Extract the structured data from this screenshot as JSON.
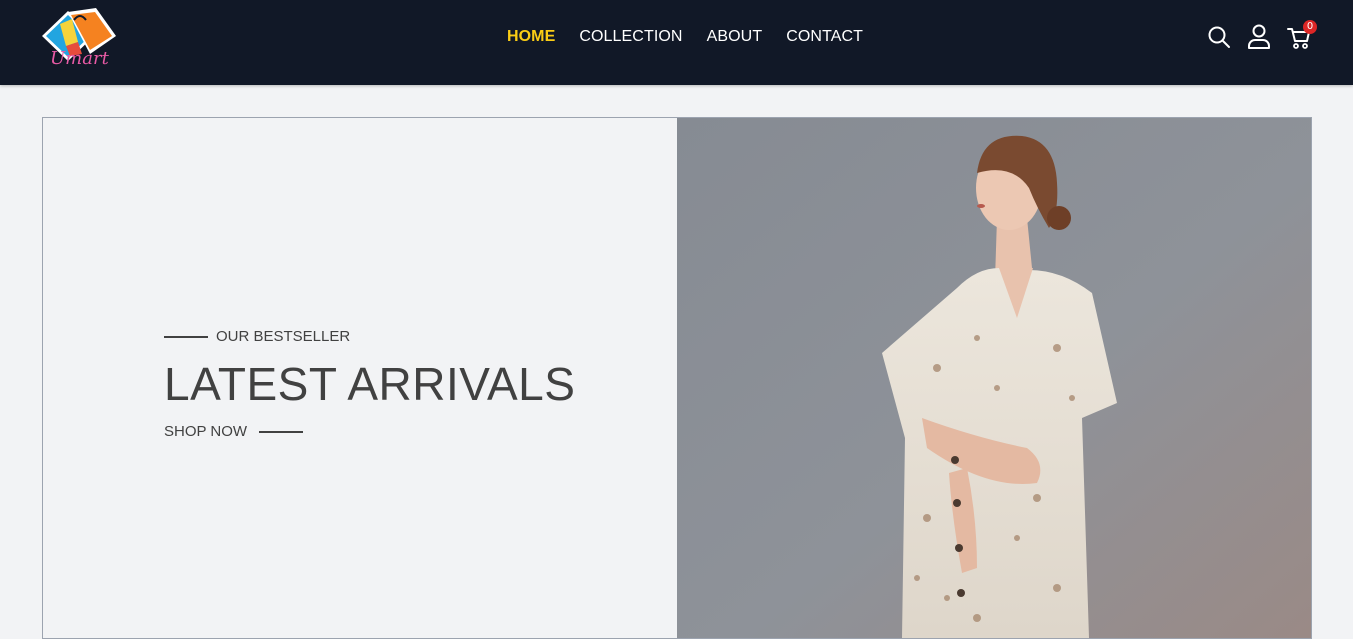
{
  "brand": {
    "logo_text": "Umart"
  },
  "nav": {
    "links": [
      {
        "label": "HOME",
        "active": true
      },
      {
        "label": "COLLECTION",
        "active": false
      },
      {
        "label": "ABOUT",
        "active": false
      },
      {
        "label": "CONTACT",
        "active": false
      }
    ],
    "cart_count": "0",
    "icons": [
      "search-icon",
      "user-icon",
      "cart-icon"
    ]
  },
  "hero": {
    "tagline": "OUR BESTSELLER",
    "headline": "LATEST ARRIVALS",
    "cta": "SHOP NOW"
  },
  "colors": {
    "navbar_bg": "#111827",
    "active_link": "#facc15",
    "text_dark": "#414141",
    "badge": "#dc2626"
  }
}
